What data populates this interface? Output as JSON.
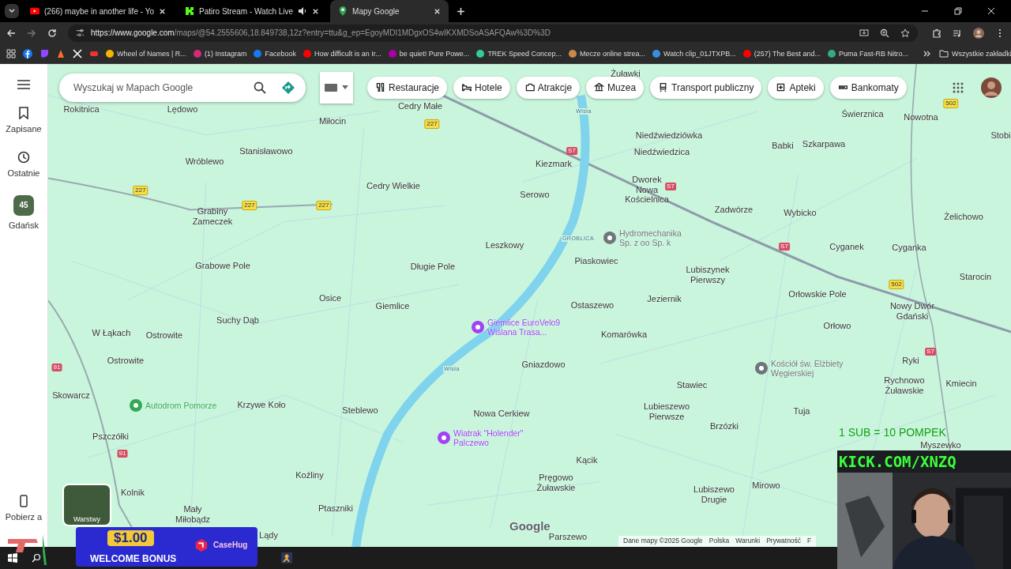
{
  "tabs": [
    {
      "title": "(266) maybe in another life - Yo",
      "selected": false,
      "audio": false
    },
    {
      "title": "Patiro Stream - Watch Live",
      "selected": false,
      "audio": true
    },
    {
      "title": "Mapy Google",
      "selected": true,
      "audio": false
    }
  ],
  "address": {
    "host": "https://www.google.com",
    "path": "/maps/@54.2555606,18.849738,12z?entry=ttu&g_ep=EgoyMDI1MDgxOS4wIKXMDSoASAFQAw%3D%3D"
  },
  "bookmarks": [
    "Wheel of Names | R...",
    "(1) Instagram",
    "Facebook",
    "How difficult is an Ir...",
    "be quiet! Pure Powe...",
    "TREK Speed Concep...",
    "Mecze online strea...",
    "Watch clip_01JTXPB...",
    "(257) The Best and...",
    "Puma Fast-RB Nitro..."
  ],
  "all_bookmarks": "Wszystkie zakładki",
  "search": {
    "placeholder": "Wyszukaj w Mapach Google"
  },
  "chips": [
    "Restauracje",
    "Hotele",
    "Atrakcje",
    "Muzea",
    "Transport publiczny",
    "Apteki",
    "Bankomaty"
  ],
  "rail": [
    {
      "label": "Zapisane"
    },
    {
      "label": "Ostatnie"
    },
    {
      "label": "Gdańsk",
      "badge": "45"
    }
  ],
  "rail_bottom": "Pobierz a",
  "layers": "Warstwy",
  "places": [
    {
      "text": "Żuławki",
      "kind": "town"
    },
    {
      "text": "Rokitnica",
      "kind": "town"
    },
    {
      "text": "Lędowo",
      "kind": "town"
    },
    {
      "text": "Cedry Małe",
      "kind": "town"
    },
    {
      "text": "Wisła",
      "kind": "river"
    },
    {
      "text": "Świerznica",
      "kind": "town"
    },
    {
      "text": "Nowotna",
      "kind": "town"
    },
    {
      "text": "Miłocin",
      "kind": "town"
    },
    {
      "text": "Niedźwiedziówka",
      "kind": "town"
    },
    {
      "text": "Stobi",
      "kind": "town"
    },
    {
      "text": "Babki",
      "kind": "town"
    },
    {
      "text": "Szkarpawa",
      "kind": "town"
    },
    {
      "text": "Stanisławowo",
      "kind": "town"
    },
    {
      "text": "Niedźwiedzica",
      "kind": "town"
    },
    {
      "text": "Wróblewo",
      "kind": "town"
    },
    {
      "text": "Kiezmark",
      "kind": "town"
    },
    {
      "text": "Cedry Wielkie",
      "kind": "town"
    },
    {
      "text": "Dworek\nNowa\nKościelnica",
      "kind": "town"
    },
    {
      "text": "Serowo",
      "kind": "town"
    },
    {
      "text": "Grabiny\nZameczek",
      "kind": "town"
    },
    {
      "text": "Zadwórze",
      "kind": "town"
    },
    {
      "text": "Wybicko",
      "kind": "town"
    },
    {
      "text": "Żelichowo",
      "kind": "town"
    },
    {
      "text": "GROBLICA",
      "kind": "river"
    },
    {
      "text": "Leszkowy",
      "kind": "town"
    },
    {
      "text": "Cyganek",
      "kind": "town"
    },
    {
      "text": "Cyganka",
      "kind": "town"
    },
    {
      "text": "Piaskowiec",
      "kind": "town"
    },
    {
      "text": "Grabowe Pole",
      "kind": "town"
    },
    {
      "text": "Długie Pole",
      "kind": "town"
    },
    {
      "text": "Lubiszynek\nPierwszy",
      "kind": "town"
    },
    {
      "text": "Starocin",
      "kind": "town"
    },
    {
      "text": "Orłowskie Pole",
      "kind": "town"
    },
    {
      "text": "Osice",
      "kind": "town"
    },
    {
      "text": "Jeziernik",
      "kind": "town"
    },
    {
      "text": "Giemlice",
      "kind": "town"
    },
    {
      "text": "Ostaszewo",
      "kind": "town"
    },
    {
      "text": "Nowy Dwór\nGdański",
      "kind": "town"
    },
    {
      "text": "Suchy Dąb",
      "kind": "town"
    },
    {
      "text": "Orłowo",
      "kind": "town"
    },
    {
      "text": "W Łąkach",
      "kind": "town"
    },
    {
      "text": "Ostrowite",
      "kind": "town"
    },
    {
      "text": "Komarówka",
      "kind": "town"
    },
    {
      "text": "Ostrowite",
      "kind": "town"
    },
    {
      "text": "Gniazdowo",
      "kind": "town"
    },
    {
      "text": "Ryki",
      "kind": "town"
    },
    {
      "text": "Wisła",
      "kind": "river"
    },
    {
      "text": "Stawiec",
      "kind": "town"
    },
    {
      "text": "Rychnowo\nŻuławskie",
      "kind": "town"
    },
    {
      "text": "Kmiecin",
      "kind": "town"
    },
    {
      "text": "Skowarcz",
      "kind": "town"
    },
    {
      "text": "Krzywe Koło",
      "kind": "town"
    },
    {
      "text": "Steblewo",
      "kind": "town"
    },
    {
      "text": "Nowa Cerkiew",
      "kind": "town"
    },
    {
      "text": "Lubieszewo\nPierwsze",
      "kind": "town"
    },
    {
      "text": "Tuja",
      "kind": "town"
    },
    {
      "text": "Brzózki",
      "kind": "town"
    },
    {
      "text": "Pszczółki",
      "kind": "town"
    },
    {
      "text": "Myszewko",
      "kind": "town"
    },
    {
      "text": "Kącik",
      "kind": "town"
    },
    {
      "text": "Koźliny",
      "kind": "town"
    },
    {
      "text": "Pręgowo\nŻuławskie",
      "kind": "town"
    },
    {
      "text": "Mirowo",
      "kind": "town"
    },
    {
      "text": "Kolnik",
      "kind": "town"
    },
    {
      "text": "Lubiszewo\nDrugie",
      "kind": "town"
    },
    {
      "text": "Mały\nMiłobądz",
      "kind": "town"
    },
    {
      "text": "Ptaszniki",
      "kind": "town"
    },
    {
      "text": "Lądy",
      "kind": "town"
    },
    {
      "text": "Parszewo",
      "kind": "town"
    }
  ],
  "pois": [
    {
      "text": "Hydromechanika\nSp. z oo Sp. k",
      "color": "#70757a"
    },
    {
      "text": "Giemlice EuroVelo9\nWiślana Trasa...",
      "color": "#a142f4"
    },
    {
      "text": "Kościół św. Elżbiety\nWęgierskiej",
      "color": "#70757a"
    },
    {
      "text": "Autodrom Pomorze",
      "color": "#34a853"
    },
    {
      "text": "Wiatrak \"Holender\"\nPalczewo",
      "color": "#a142f4"
    }
  ],
  "shields": [
    {
      "text": "502",
      "kind": "national"
    },
    {
      "text": "227",
      "kind": "national"
    },
    {
      "text": "S7",
      "kind": "express"
    },
    {
      "text": "S7",
      "kind": "express"
    },
    {
      "text": "227",
      "kind": "national"
    },
    {
      "text": "227",
      "kind": "national"
    },
    {
      "text": "227",
      "kind": "national"
    },
    {
      "text": "S7",
      "kind": "express"
    },
    {
      "text": "502",
      "kind": "national"
    },
    {
      "text": "S7",
      "kind": "express"
    },
    {
      "text": "91",
      "kind": "express"
    },
    {
      "text": "91",
      "kind": "express"
    }
  ],
  "logo": "Google",
  "attribution": [
    "Dane mapy ©2025 Google",
    "Polska",
    "Warunki",
    "Prywatność",
    "F"
  ],
  "ad": {
    "amount": "$1.00",
    "caption": "WELCOME BONUS",
    "brand": "CaseHug"
  },
  "stream": {
    "promo": "1 SUB = 10 POMPEK",
    "channel": "KICK.COM/XNZQ"
  }
}
